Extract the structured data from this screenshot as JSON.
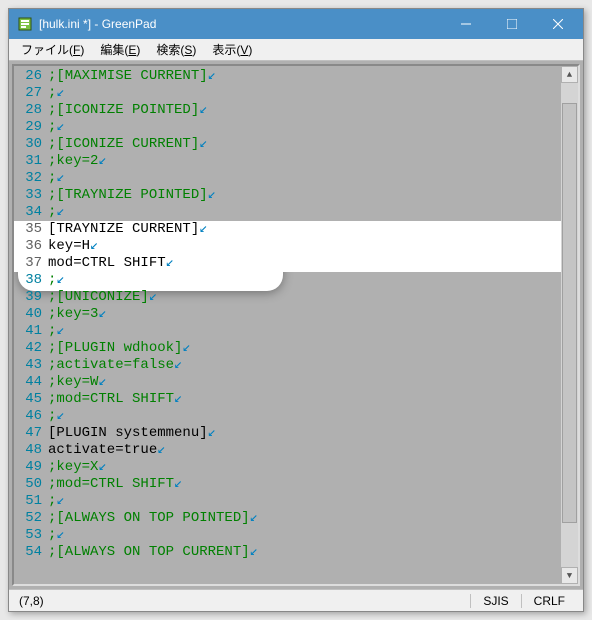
{
  "title": "[hulk.ini *] - GreenPad",
  "menus": {
    "file": "ファイル(F)",
    "edit": "編集(E)",
    "search": "検索(S)",
    "view": "表示(V)"
  },
  "lines": [
    {
      "n": "26",
      "t": ";[MAXIMISE CURRENT]",
      "cls": "comment"
    },
    {
      "n": "27",
      "t": ";",
      "cls": "comment"
    },
    {
      "n": "28",
      "t": ";[ICONIZE POINTED]",
      "cls": "comment"
    },
    {
      "n": "29",
      "t": ";",
      "cls": "comment"
    },
    {
      "n": "30",
      "t": ";[ICONIZE CURRENT]",
      "cls": "comment"
    },
    {
      "n": "31",
      "t": ";key=2",
      "cls": "comment"
    },
    {
      "n": "32",
      "t": ";",
      "cls": "comment"
    },
    {
      "n": "33",
      "t": ";[TRAYNIZE POINTED]",
      "cls": "comment"
    },
    {
      "n": "34",
      "t": ";",
      "cls": "comment"
    },
    {
      "n": "35",
      "t": "[TRAYNIZE CURRENT]",
      "cls": "text",
      "hl": true
    },
    {
      "n": "36",
      "t": "key=H",
      "cls": "text",
      "hl": true
    },
    {
      "n": "37",
      "t": "mod=CTRL SHIFT",
      "cls": "text",
      "hl": true
    },
    {
      "n": "38",
      "t": ";",
      "cls": "comment"
    },
    {
      "n": "39",
      "t": ";[UNICONIZE]",
      "cls": "comment"
    },
    {
      "n": "40",
      "t": ";key=3",
      "cls": "comment"
    },
    {
      "n": "41",
      "t": ";",
      "cls": "comment"
    },
    {
      "n": "42",
      "t": ";[PLUGIN wdhook]",
      "cls": "comment"
    },
    {
      "n": "43",
      "t": ";activate=false",
      "cls": "comment"
    },
    {
      "n": "44",
      "t": ";key=W",
      "cls": "comment"
    },
    {
      "n": "45",
      "t": ";mod=CTRL SHIFT",
      "cls": "comment"
    },
    {
      "n": "46",
      "t": ";",
      "cls": "comment"
    },
    {
      "n": "47",
      "t": "[PLUGIN systemmenu]",
      "cls": "text"
    },
    {
      "n": "48",
      "t": "activate=true",
      "cls": "text"
    },
    {
      "n": "49",
      "t": ";key=X",
      "cls": "comment"
    },
    {
      "n": "50",
      "t": ";mod=CTRL SHIFT",
      "cls": "comment"
    },
    {
      "n": "51",
      "t": ";",
      "cls": "comment"
    },
    {
      "n": "52",
      "t": ";[ALWAYS ON TOP POINTED]",
      "cls": "comment"
    },
    {
      "n": "53",
      "t": ";",
      "cls": "comment"
    },
    {
      "n": "54",
      "t": ";[ALWAYS ON TOP CURRENT]",
      "cls": "comment"
    }
  ],
  "eol_mark": "↙",
  "status": {
    "pos": "(7,8)",
    "enc": "SJIS",
    "nl": "CRLF"
  }
}
